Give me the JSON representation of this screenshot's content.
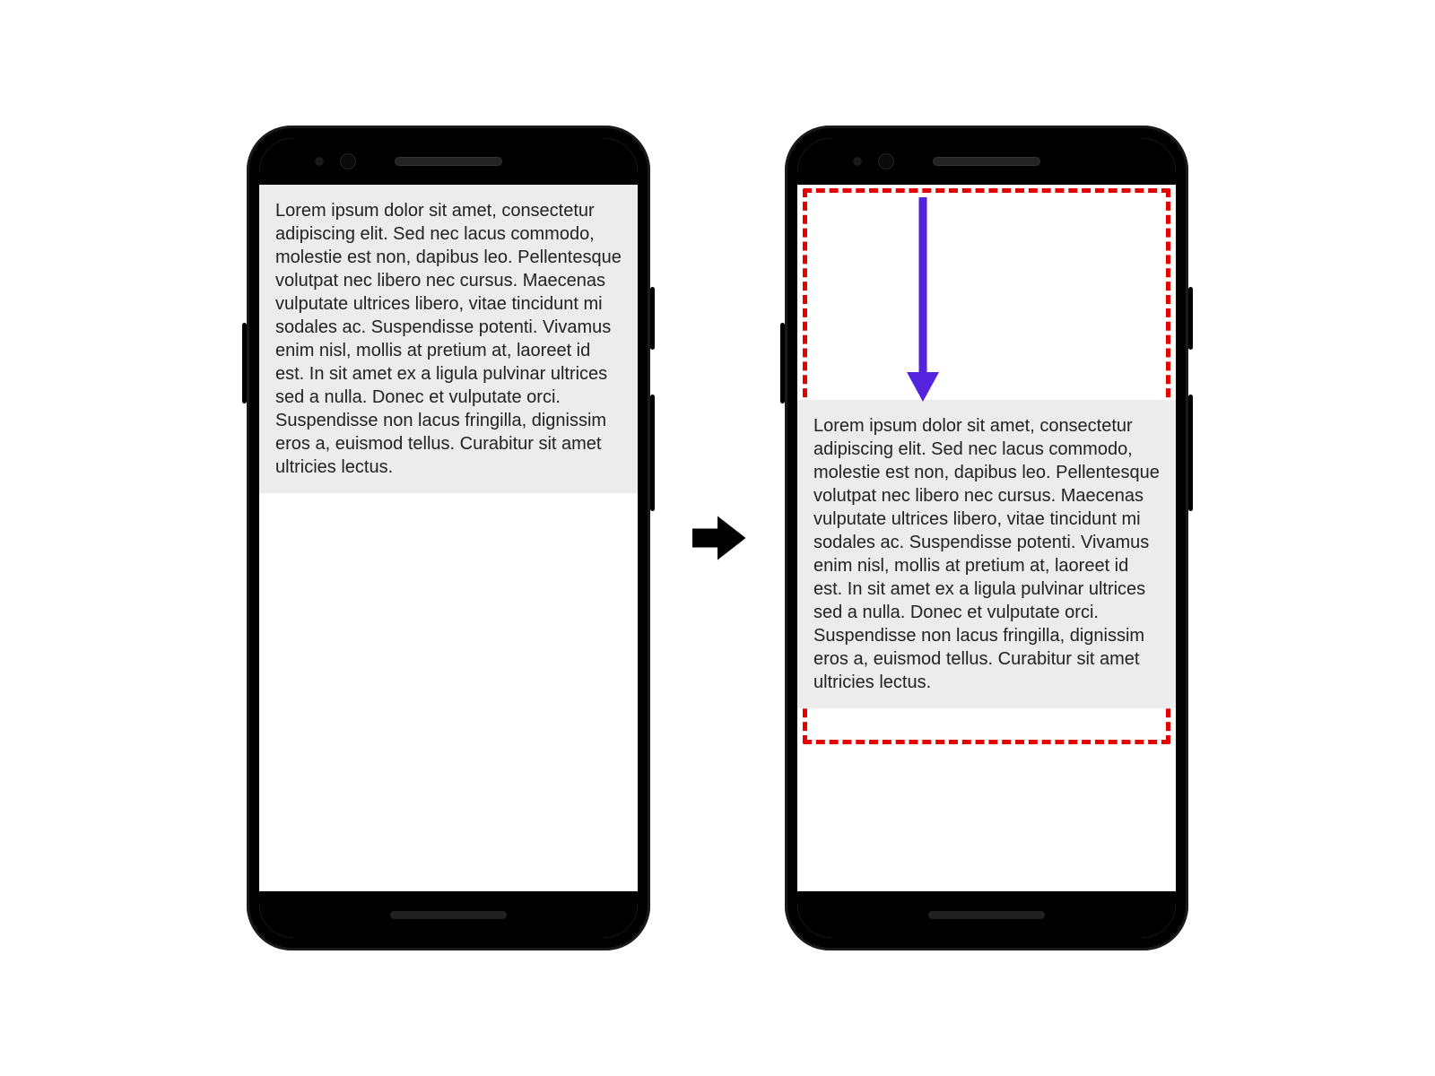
{
  "lorem_text": "Lorem ipsum dolor sit amet, consectetur adipiscing elit. Sed nec lacus commodo, molestie est non, dapibus leo. Pellentesque volutpat nec libero nec cursus. Maecenas vulputate ultrices libero, vitae tincidunt mi sodales ac. Suspendisse potenti. Vivamus enim nisl, mollis at pretium at, laoreet id est. In sit amet ex a ligula pulvinar ultrices sed a nulla. Donec et vulputate orci. Suspendisse non lacus fringilla, dignissim eros a, euismod tellus. Curabitur sit amet ultricies lectus.",
  "colors": {
    "dashed_border": "#e60000",
    "arrow_down": "#5522dd",
    "arrow_right": "#000000",
    "text_bg": "#ececec"
  }
}
